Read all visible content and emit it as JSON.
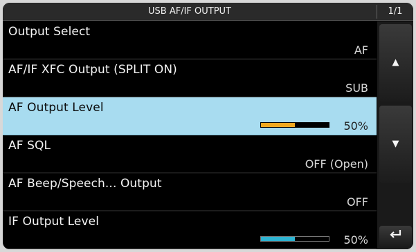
{
  "header": {
    "title": "USB AF/IF OUTPUT",
    "page": "1/1"
  },
  "menu": {
    "items": [
      {
        "label": "Output Select",
        "value": "AF",
        "selected": false
      },
      {
        "label": "AF/IF XFC Output (SPLIT ON)",
        "value": "SUB",
        "selected": false
      },
      {
        "label": "AF Output Level",
        "value": "50%",
        "level": 0.5,
        "bar_color": "#f0a820",
        "selected": true
      },
      {
        "label": "AF SQL",
        "value": "OFF (Open)",
        "selected": false
      },
      {
        "label": "AF Beep/Speech... Output",
        "value": "OFF",
        "selected": false
      },
      {
        "label": "IF Output Level",
        "value": "50%",
        "level": 0.5,
        "bar_color": "#2eb4d2",
        "selected": false
      }
    ]
  },
  "side": {
    "up_icon": "▲",
    "down_icon": "▼",
    "back_icon": "⮐"
  },
  "colors": {
    "selected_bg": "#a8dcf0",
    "screen_bg": "#000000"
  }
}
